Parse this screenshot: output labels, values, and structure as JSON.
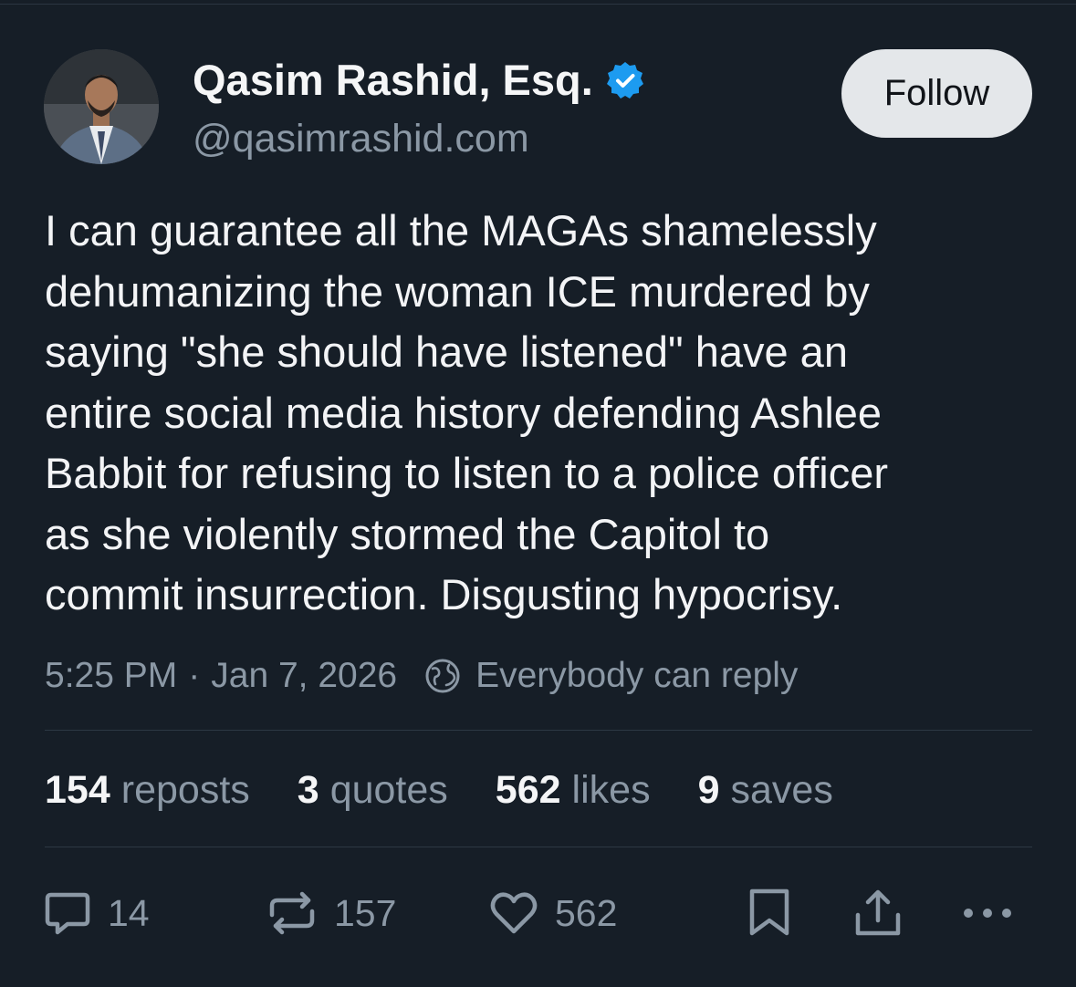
{
  "post": {
    "author": {
      "name": "Qasim Rashid, Esq.",
      "handle": "@qasimrashid.com",
      "verified": true
    },
    "follow_label": "Follow",
    "text_lines": [
      "I can guarantee all the MAGAs shamelessly",
      "dehumanizing the woman ICE murdered by",
      "saying \"she should have listened\" have an",
      "entire social media history defending Ashlee",
      "Babbit for refusing to listen to a police officer",
      "as she violently stormed the Capitol to",
      "commit insurrection. Disgusting hypocrisy."
    ],
    "time": "5:25 PM",
    "separator": "·",
    "date": "Jan 7, 2026",
    "reply_setting": "Everybody can reply"
  },
  "stats": [
    {
      "count": "154",
      "label": "reposts"
    },
    {
      "count": "3",
      "label": "quotes"
    },
    {
      "count": "562",
      "label": "likes"
    },
    {
      "count": "9",
      "label": "saves"
    }
  ],
  "actions": {
    "reply_count": "14",
    "repost_count": "157",
    "like_count": "562"
  },
  "colors": {
    "background": "#161e27",
    "text_primary": "#f3f4f6",
    "text_secondary": "#8b98a5",
    "verified_blue": "#1d9bf0",
    "follow_button_bg": "#e4e7ea"
  },
  "icons": [
    "verified-badge-icon",
    "globe-icon",
    "reply-icon",
    "repost-icon",
    "heart-icon",
    "bookmark-icon",
    "share-icon",
    "more-icon"
  ]
}
